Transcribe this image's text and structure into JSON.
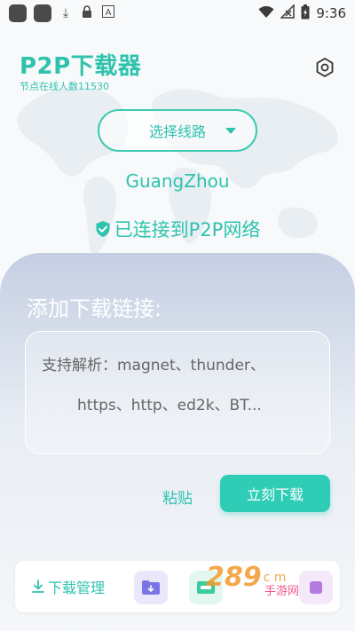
{
  "status_bar": {
    "time": "9:36",
    "left_icons": [
      "app-icon",
      "app-icon",
      "download-icon",
      "lock-icon",
      "a-icon"
    ],
    "right_icons": [
      "wifi-icon",
      "no-sim-icon",
      "battery-charging-icon"
    ]
  },
  "header": {
    "title": "P2P下载器",
    "node_count": "节点在线人数11530",
    "settings_icon": "hexagon-settings-icon"
  },
  "route": {
    "label": "选择线路"
  },
  "location": {
    "city": "GuangZhou"
  },
  "connection": {
    "status": "已连接到P2P网络"
  },
  "panel": {
    "title": "添加下载链接:",
    "hint_line1": "支持解析：magnet、thunder、",
    "hint_line2": "https、http、ed2k、BT...",
    "paste_label": "粘贴",
    "download_label": "立刻下载"
  },
  "bottom_bar": {
    "manage_label": "下载管理"
  },
  "watermark": {
    "num": "289",
    "suffix": "c m",
    "sub": "手游网"
  },
  "colors": {
    "accent": "#2fc3ae",
    "button": "#2fcdb6"
  }
}
